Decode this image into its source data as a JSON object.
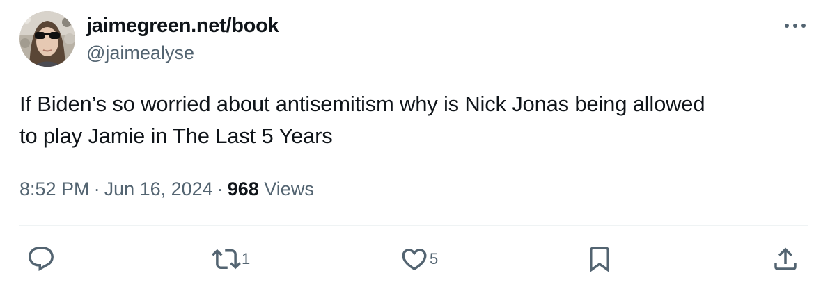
{
  "author": {
    "name": "jaimegreen.net/book",
    "handle": "@jaimealyse"
  },
  "tweet": {
    "text_line1": "If Biden’s so worried about antisemitism why is Nick Jonas being allowed",
    "text_line2": "to play Jamie in The Last 5 Years"
  },
  "meta": {
    "time": "8:52 PM",
    "separator": "·",
    "date": "Jun 16, 2024",
    "views_count": "968",
    "views_label": "Views"
  },
  "actions": {
    "reply": {
      "icon": "reply-icon",
      "count": ""
    },
    "retweet": {
      "icon": "retweet-icon",
      "count": "1"
    },
    "like": {
      "icon": "heart-icon",
      "count": "5"
    },
    "bookmark": {
      "icon": "bookmark-icon",
      "count": ""
    },
    "share": {
      "icon": "share-icon",
      "count": ""
    }
  },
  "colors": {
    "text": "#0f1419",
    "secondary": "#536471",
    "divider": "#eff3f4"
  }
}
